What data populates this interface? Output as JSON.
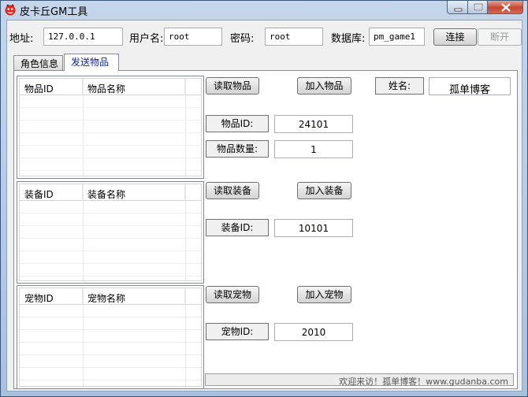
{
  "window": {
    "title": "皮卡丘GM工具",
    "colors": {
      "frame": "#a9c1dc",
      "client": "#f0f0f0",
      "tab_active_text": "#0a26a5",
      "close": "#c6452f"
    }
  },
  "connection": {
    "address_label": "地址:",
    "address_value": "127.0.0.1",
    "user_label": "用户名:",
    "user_value": "root",
    "password_label": "密码:",
    "password_value": "root",
    "database_label": "数据库:",
    "database_value": "pm_game1",
    "connect_label": "连接",
    "disconnect_label": "断开"
  },
  "tabs": [
    "角色信息",
    "发送物品"
  ],
  "items": {
    "col_id": "物品ID",
    "col_name": "物品名称",
    "read_label": "读取物品",
    "add_label": "加入物品",
    "id_label": "物品ID:",
    "id_value": "24101",
    "qty_label": "物品数量:",
    "qty_value": "1"
  },
  "character": {
    "name_label": "姓名:",
    "name_value": "孤单博客"
  },
  "equipment": {
    "col_id": "装备ID",
    "col_name": "装备名称",
    "read_label": "读取装备",
    "add_label": "加入装备",
    "id_label": "装备ID:",
    "id_value": "10101"
  },
  "pets": {
    "col_id": "宠物ID",
    "col_name": "宠物名称",
    "read_label": "读取宠物",
    "add_label": "加入宠物",
    "id_label": "宠物ID:",
    "id_value": "2010"
  },
  "status_text": "欢迎来访！孤单博客！www.gudanba.com"
}
